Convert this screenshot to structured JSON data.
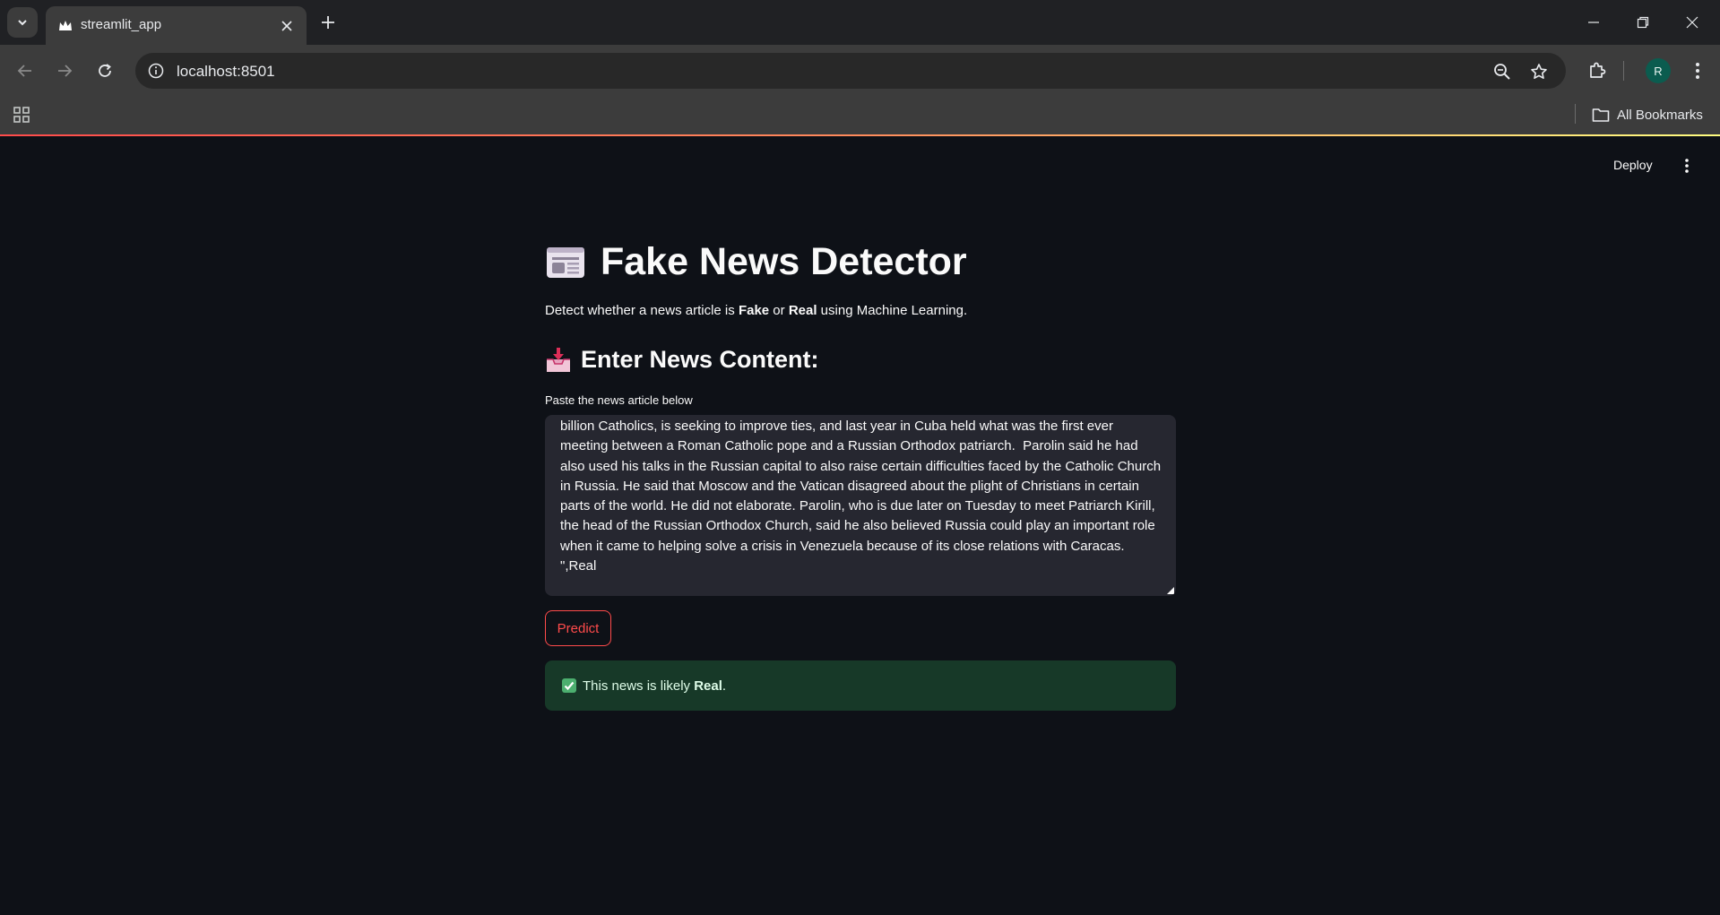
{
  "browser": {
    "tab_title": "streamlit_app",
    "url": "localhost:8501",
    "avatar_letter": "R",
    "bookmarks_label": "All Bookmarks"
  },
  "app": {
    "deploy_label": "Deploy",
    "title": "Fake News Detector",
    "title_emoji": "newspaper-icon",
    "subtitle": {
      "prefix": "Detect whether a news article is ",
      "fake": "Fake",
      "or": " or ",
      "real": "Real",
      "suffix": " using Machine Learning."
    },
    "section_heading": "Enter News Content:",
    "section_emoji": "inbox-tray-icon",
    "textarea_label": "Paste the news article below",
    "textarea_value": "billion Catholics, is seeking to improve ties, and last year in Cuba held what was the first ever meeting between a Roman Catholic pope and a Russian Orthodox patriarch.  Parolin said he had also used his talks in the Russian capital to also raise certain difficulties faced by the Catholic Church in Russia. He said that Moscow and the Vatican disagreed about the plight of Christians in certain parts of the world. He did not elaborate. Parolin, who is due later on Tuesday to meet Patriarch Kirill, the head of the Russian Orthodox Church, said he also believed Russia could play an important role when it came to helping solve a crisis in Venezuela because of its close relations with Caracas.    \",Real",
    "predict_label": "Predict",
    "result": {
      "prefix": "This news is likely ",
      "verdict": "Real",
      "suffix": "."
    }
  },
  "colors": {
    "background": "#0e1117",
    "accent": "#ff4b4b",
    "success_bg": "#173928",
    "input_bg": "#262730"
  }
}
